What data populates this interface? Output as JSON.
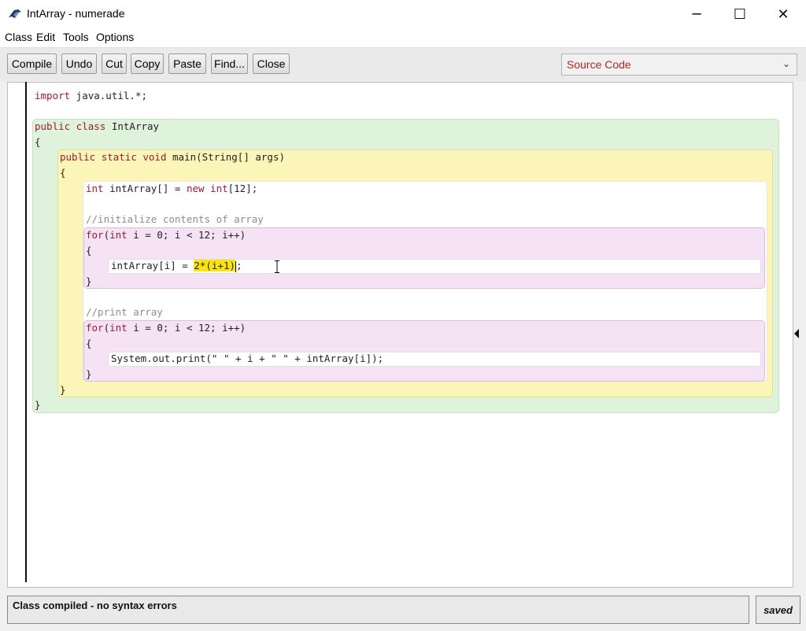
{
  "window": {
    "title": "IntArray - numerade",
    "minimize_glyph": "─",
    "maximize_glyph": "☐",
    "close_glyph": "✕"
  },
  "menu": {
    "class": "Class",
    "edit": "Edit",
    "tools": "Tools",
    "options": "Options"
  },
  "toolbar": {
    "compile": "Compile",
    "undo": "Undo",
    "cut": "Cut",
    "copy": "Copy",
    "paste": "Paste",
    "find": "Find...",
    "close": "Close"
  },
  "view_select": {
    "value": "Source Code",
    "arrow": "⌄"
  },
  "code": {
    "import_kw": "import",
    "import_rest": " java.util.*;",
    "class_public": "public",
    "class_kw": "class",
    "class_name": " IntArray",
    "class_open": "{",
    "class_close": "}",
    "method_public": "public",
    "method_static": "static",
    "method_void": "void",
    "method_rest": " main(String[] args)",
    "method_open": "{",
    "method_close": "}",
    "decl_int": "int",
    "decl_mid": " intArray[] = ",
    "decl_new": "new",
    "decl_int2": "int",
    "decl_end": "[12];",
    "comment1": "//initialize contents of array",
    "for1_kw": "for",
    "for1_paren": "(",
    "for1_int": "int",
    "for1_rest": " i = 0; i < 12; i++)",
    "for1_open": "{",
    "for1_close": "}",
    "stmt1_pre": "intArray[i] = ",
    "stmt1_hl": "2*(i+1)",
    "stmt1_end": ";",
    "comment2": "//print array",
    "for2_kw": "for",
    "for2_paren": "(",
    "for2_int": "int",
    "for2_rest": " i = 0; i < 12; i++)",
    "for2_open": "{",
    "for2_close": "}",
    "stmt2": "System.out.print(\" \" + i + \" \" + intArray[i]);"
  },
  "status": {
    "message": "Class compiled - no syntax errors",
    "saved": "saved"
  }
}
